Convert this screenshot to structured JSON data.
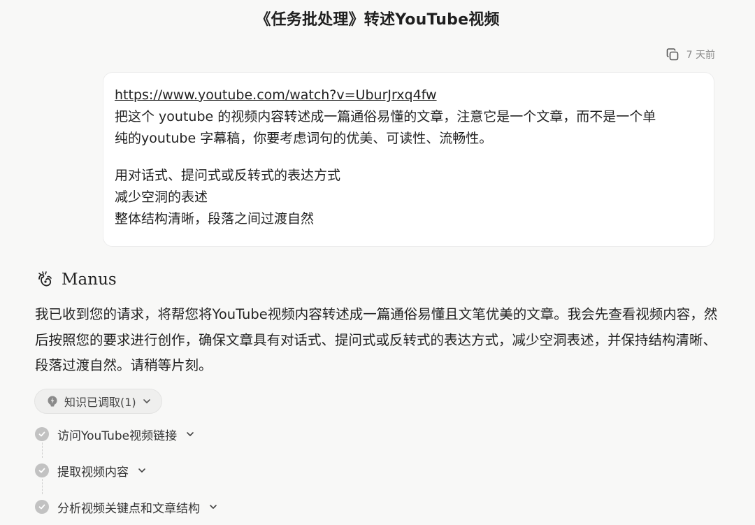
{
  "page": {
    "title": "《任务批处理》转述YouTube视频"
  },
  "meta": {
    "timestamp": "7 天前",
    "copy_icon": "copy-icon"
  },
  "user_message": {
    "link": "https://www.youtube.com/watch?v=UburJrxq4fw",
    "line1": "把这个 youtube 的视频内容转述成一篇通俗易懂的文章，注意它是一个文章，而不是一个单",
    "line2": "纯的youtube 字幕稿，你要考虑词句的优美、可读性、流畅性。",
    "line3": "用对话式、提问式或反转式的表达方式",
    "line4": "减少空洞的表述",
    "line5": "整体结构清晰，段落之间过渡自然"
  },
  "agent": {
    "name": "Manus",
    "logo_icon": "manus-logo-icon",
    "message": "我已收到您的请求，将帮您将YouTube视频内容转述成一篇通俗易懂且文笔优美的文章。我会先查看视频内容，然后按照您的要求进行创作，确保文章具有对话式、提问式或反转式的表达方式，减少空洞表述，并保持结构清晰、段落过渡自然。请稍等片刻。"
  },
  "knowledge_chip": {
    "label": "知识已调取(1)",
    "icon": "lightbulb-icon"
  },
  "steps": [
    {
      "label": "访问YouTube视频链接",
      "status": "done"
    },
    {
      "label": "提取视频内容",
      "status": "done"
    },
    {
      "label": "分析视频关键点和文章结构",
      "status": "done"
    }
  ],
  "colors": {
    "background": "#f8f8f7",
    "bubble": "#ffffff",
    "chip": "#efefee",
    "check": "#c2c2c2"
  }
}
